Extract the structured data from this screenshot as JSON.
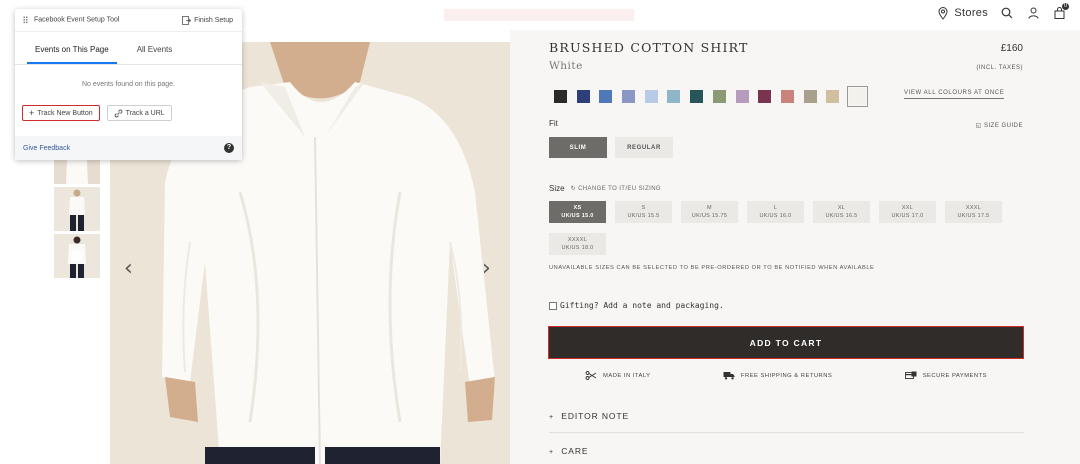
{
  "nav": {
    "stores_label": "Stores",
    "cart_count": "0"
  },
  "fb_tool": {
    "title": "Facebook Event Setup Tool",
    "finish_label": "Finish Setup",
    "tabs": [
      {
        "label": "Events on This Page",
        "active": true
      },
      {
        "label": "All Events",
        "active": false
      }
    ],
    "empty_message": "No events found on this page.",
    "track_button_label": "Track New Button",
    "track_url_label": "Track a URL",
    "feedback_label": "Give Feedback",
    "help_label": "?"
  },
  "product": {
    "title": "BRUSHED COTTON SHIRT",
    "colour": "White",
    "price": "£160",
    "tax_note": "(INCL. TAXES)",
    "swatches": [
      {
        "color": "#2b2a27",
        "selected": false
      },
      {
        "color": "#2e3e78",
        "selected": false
      },
      {
        "color": "#4f78b8",
        "selected": false
      },
      {
        "color": "#8a97c4",
        "selected": false
      },
      {
        "color": "#b7cbe6",
        "selected": false
      },
      {
        "color": "#8eb6c8",
        "selected": false
      },
      {
        "color": "#27555a",
        "selected": false
      },
      {
        "color": "#8b9a74",
        "selected": false
      },
      {
        "color": "#b79bbd",
        "selected": false
      },
      {
        "color": "#7a3450",
        "selected": false
      },
      {
        "color": "#c9837c",
        "selected": false
      },
      {
        "color": "#a8a08a",
        "selected": false
      },
      {
        "color": "#cfbf9e",
        "selected": false
      },
      {
        "color": "#f3f1ec",
        "selected": true
      }
    ],
    "view_all_colours": "VIEW ALL COLOURS AT ONCE",
    "fit_label": "Fit",
    "size_guide": "SIZE GUIDE",
    "fits": [
      {
        "label": "SLIM",
        "selected": true
      },
      {
        "label": "REGULAR",
        "selected": false
      }
    ],
    "size_label": "Size",
    "change_sizing": "CHANGE TO IT/EU SIZING",
    "sizes": [
      {
        "size": "XS",
        "uk": "UK/US 15.0",
        "selected": true
      },
      {
        "size": "S",
        "uk": "UK/US 15.5",
        "selected": false
      },
      {
        "size": "M",
        "uk": "UK/US 15.75",
        "selected": false
      },
      {
        "size": "L",
        "uk": "UK/US 16.0",
        "selected": false
      },
      {
        "size": "XL",
        "uk": "UK/US 16.5",
        "selected": false
      },
      {
        "size": "XXL",
        "uk": "UK/US 17.0",
        "selected": false
      },
      {
        "size": "XXXL",
        "uk": "UK/US 17.5",
        "selected": false
      },
      {
        "size": "XXXXL",
        "uk": "UK/US 18.0",
        "selected": false
      }
    ],
    "unavailable_note": "UNAVAILABLE SIZES CAN BE SELECTED TO BE PRE-ORDERED OR TO BE NOTIFIED WHEN AVAILABLE",
    "gift_label": "Gifting? Add a note and packaging.",
    "add_to_cart": "ADD TO CART",
    "features": [
      {
        "icon": "scissors-icon",
        "label": "MADE IN ITALY"
      },
      {
        "icon": "truck-icon",
        "label": "FREE SHIPPING & RETURNS"
      },
      {
        "icon": "payment-icon",
        "label": "SECURE PAYMENTS"
      }
    ],
    "accordion": [
      {
        "label": "EDITOR NOTE"
      },
      {
        "label": "CARE"
      }
    ]
  },
  "colors": {
    "accent_blue": "#1877f2",
    "highlight_red": "#d02c2c",
    "cart_button": "#2f2c29"
  }
}
